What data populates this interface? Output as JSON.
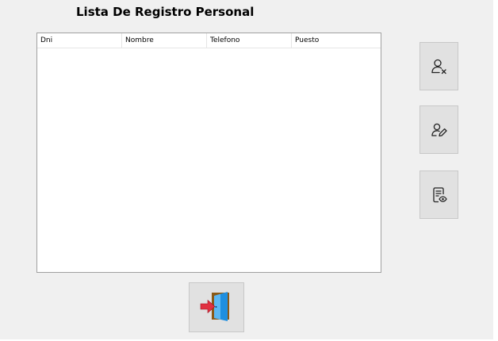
{
  "window": {
    "title": "Lista De Registro Personal"
  },
  "table": {
    "columns": [
      "Dni",
      "Nombre",
      "Telefono",
      "Puesto"
    ],
    "rows": []
  },
  "buttons": {
    "delete_icon": "user-remove-icon",
    "edit_icon": "user-edit-icon",
    "view_icon": "document-view-icon",
    "exit_icon": "exit-door-icon"
  },
  "colors": {
    "background": "#f0f0f0",
    "button_face": "#e1e1e1",
    "exit_arrow": "#e03040",
    "exit_door": "#1e8fe0"
  }
}
